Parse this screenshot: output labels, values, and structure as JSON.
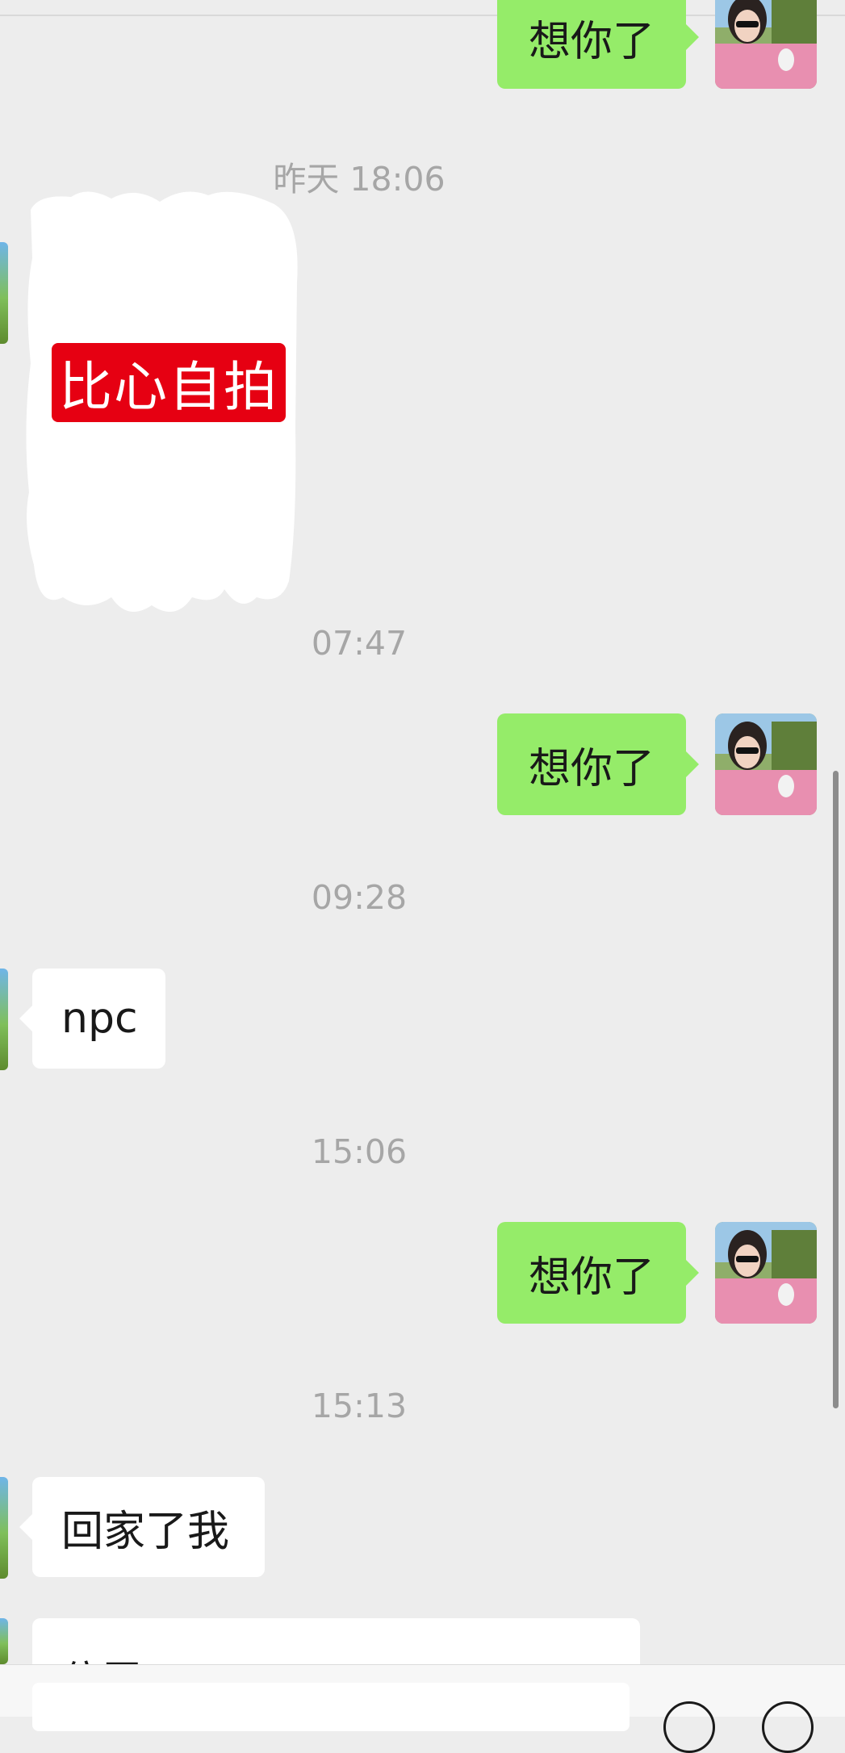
{
  "chat": {
    "top_message": "想你了",
    "timestamps": {
      "t1": "昨天 18:06",
      "t2": "07:47",
      "t3": "09:28",
      "t4": "15:06",
      "t5": "15:13"
    },
    "sticker_label": "比心自拍",
    "sent_1": "想你了",
    "recv_1": "npc",
    "sent_2": "想你了",
    "recv_2": "回家了我",
    "partial_card_title": "位置"
  },
  "colors": {
    "background": "#ededed",
    "sent_bubble": "#95ec69",
    "received_bubble": "#ffffff",
    "timestamp": "#a6a6a6",
    "sticker_label_bg": "#e60012"
  },
  "icons": {
    "voice": "voice-icon",
    "emoji": "emoji-icon"
  }
}
